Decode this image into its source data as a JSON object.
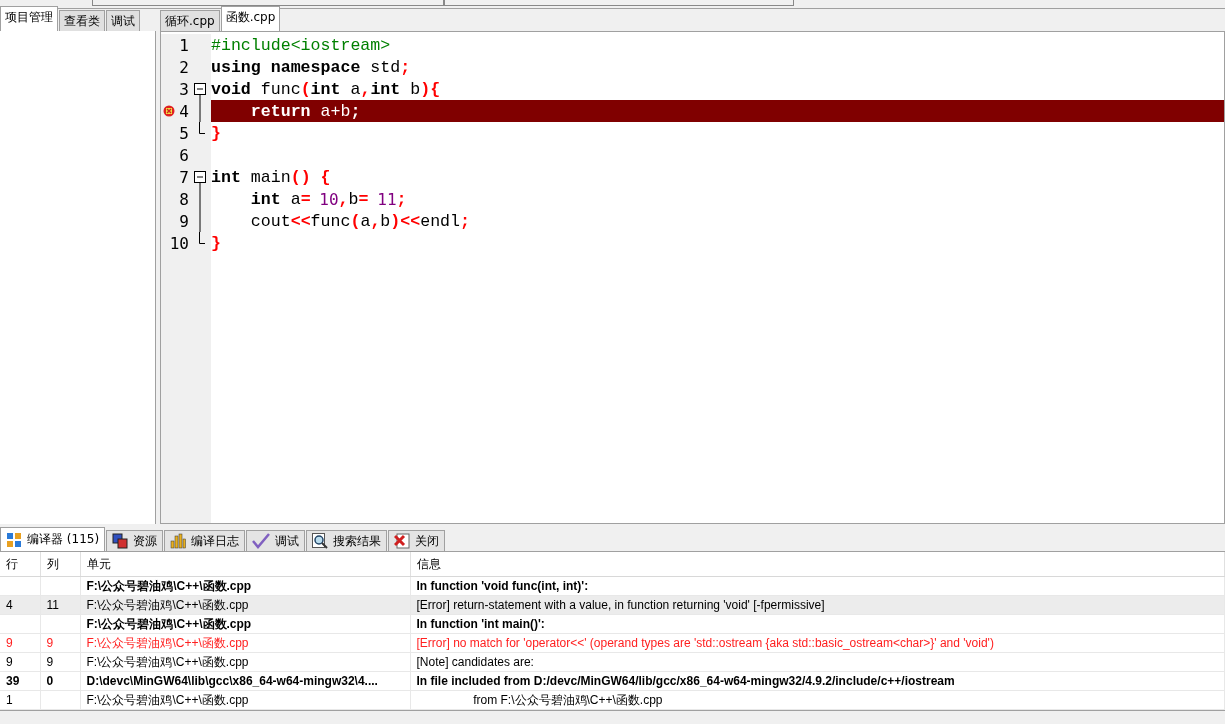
{
  "left_tabs": [
    {
      "label": "项目管理",
      "selected": true
    },
    {
      "label": "查看类",
      "selected": false
    },
    {
      "label": "调试",
      "selected": false
    }
  ],
  "editor_tabs": [
    {
      "label": "循环.cpp",
      "selected": false
    },
    {
      "label": "函数.cpp",
      "selected": true
    }
  ],
  "code_lines": [
    {
      "number": "1",
      "kind": "plain",
      "error": false,
      "tokens": [
        {
          "kind": "pre",
          "text": "#include<iostream>"
        }
      ]
    },
    {
      "number": "2",
      "kind": "plain",
      "error": false,
      "tokens": [
        {
          "kind": "kw",
          "text": "using namespace"
        },
        {
          "kind": "id",
          "text": " std"
        },
        {
          "kind": "punct",
          "text": ";"
        }
      ]
    },
    {
      "number": "3",
      "kind": "foldstart",
      "error": false,
      "tokens": [
        {
          "kind": "kw",
          "text": "void"
        },
        {
          "kind": "id",
          "text": " func"
        },
        {
          "kind": "punct",
          "text": "("
        },
        {
          "kind": "kw",
          "text": "int"
        },
        {
          "kind": "id",
          "text": " a"
        },
        {
          "kind": "punct",
          "text": ","
        },
        {
          "kind": "kw",
          "text": "int"
        },
        {
          "kind": "id",
          "text": " b"
        },
        {
          "kind": "punct",
          "text": "){"
        }
      ]
    },
    {
      "number": "4",
      "kind": "foldbody",
      "error": true,
      "tokens": [
        {
          "kind": "kw",
          "text": "    return"
        },
        {
          "kind": "id",
          "text": " a+b"
        },
        {
          "kind": "punct",
          "text": ";"
        }
      ]
    },
    {
      "number": "5",
      "kind": "foldend",
      "error": false,
      "tokens": [
        {
          "kind": "punct",
          "text": "}"
        }
      ]
    },
    {
      "number": "6",
      "kind": "plain",
      "error": false
    },
    {
      "number": "7",
      "kind": "foldstart",
      "error": false,
      "tokens": [
        {
          "kind": "kw",
          "text": "int"
        },
        {
          "kind": "id",
          "text": " main"
        },
        {
          "kind": "punct",
          "text": "() {"
        }
      ]
    },
    {
      "number": "8",
      "kind": "foldbody",
      "error": false,
      "tokens": [
        {
          "kind": "kw",
          "text": "    int"
        },
        {
          "kind": "id",
          "text": " a"
        },
        {
          "kind": "punct",
          "text": "="
        },
        {
          "kind": "num",
          "text": "10"
        },
        {
          "kind": "punct",
          "text": ","
        },
        {
          "kind": "id",
          "text": "b"
        },
        {
          "kind": "punct",
          "text": "="
        },
        {
          "kind": "num",
          "text": "11"
        },
        {
          "kind": "punct",
          "text": ";"
        }
      ]
    },
    {
      "number": "9",
      "kind": "foldbody",
      "error": false,
      "tokens": [
        {
          "kind": "id",
          "text": "    cout"
        },
        {
          "kind": "punct",
          "text": "<<"
        },
        {
          "kind": "id",
          "text": "func"
        },
        {
          "kind": "punct",
          "text": "("
        },
        {
          "kind": "id",
          "text": "a"
        },
        {
          "kind": "punct",
          "text": ","
        },
        {
          "kind": "id",
          "text": "b"
        },
        {
          "kind": "punct",
          "text": ")<<"
        },
        {
          "kind": "id",
          "text": "endl"
        },
        {
          "kind": "punct",
          "text": ";"
        }
      ]
    },
    {
      "number": "10",
      "kind": "foldend",
      "error": false,
      "tokens": [
        {
          "kind": "punct",
          "text": "}"
        }
      ]
    }
  ],
  "bottom_tabs": [
    {
      "kind": "compiler",
      "label": "编译器 (115)",
      "selected": true
    },
    {
      "kind": "resources",
      "label": "资源",
      "selected": false
    },
    {
      "kind": "log",
      "label": "编译日志",
      "selected": false
    },
    {
      "kind": "debug",
      "label": "调试",
      "selected": false
    },
    {
      "kind": "search",
      "label": "搜索结果",
      "selected": false
    },
    {
      "kind": "close",
      "label": "关闭",
      "selected": false
    }
  ],
  "messages": {
    "columns": [
      "行",
      "列",
      "单元",
      "信息"
    ],
    "rows": [
      {
        "kind": "header",
        "selected": false,
        "line": "",
        "col": "",
        "unit": "F:\\公众号碧油鸡\\C++\\函数.cpp",
        "info": "In function 'void func(int, int)':"
      },
      {
        "kind": "normal",
        "selected": true,
        "line": "4",
        "col": "11",
        "unit": "F:\\公众号碧油鸡\\C++\\函数.cpp",
        "info": "[Error] return-statement with a value, in function returning 'void' [-fpermissive]"
      },
      {
        "kind": "header",
        "selected": false,
        "line": "",
        "col": "",
        "unit": "F:\\公众号碧油鸡\\C++\\函数.cpp",
        "info": "In function 'int main()':"
      },
      {
        "kind": "error",
        "selected": false,
        "line": "9",
        "col": "9",
        "unit": "F:\\公众号碧油鸡\\C++\\函数.cpp",
        "info": "[Error] no match for 'operator<<' (operand types are 'std::ostream {aka std::basic_ostream<char>}' and 'void')"
      },
      {
        "kind": "normal",
        "selected": false,
        "line": "9",
        "col": "9",
        "unit": "F:\\公众号碧油鸡\\C++\\函数.cpp",
        "info": "[Note] candidates are:"
      },
      {
        "kind": "header",
        "selected": false,
        "line": "39",
        "col": "0",
        "unit": "D:\\devc\\MinGW64\\lib\\gcc\\x86_64-w64-mingw32\\4....",
        "info": "In file included from D:/devc/MinGW64/lib/gcc/x86_64-w64-mingw32/4.9.2/include/c++/iostream"
      },
      {
        "kind": "normal",
        "selected": false,
        "line": "1",
        "col": "",
        "unit": "F:\\公众号碧油鸡\\C++\\函数.cpp",
        "info": "                 from F:\\公众号碧油鸡\\C++\\函数.cpp"
      }
    ]
  }
}
